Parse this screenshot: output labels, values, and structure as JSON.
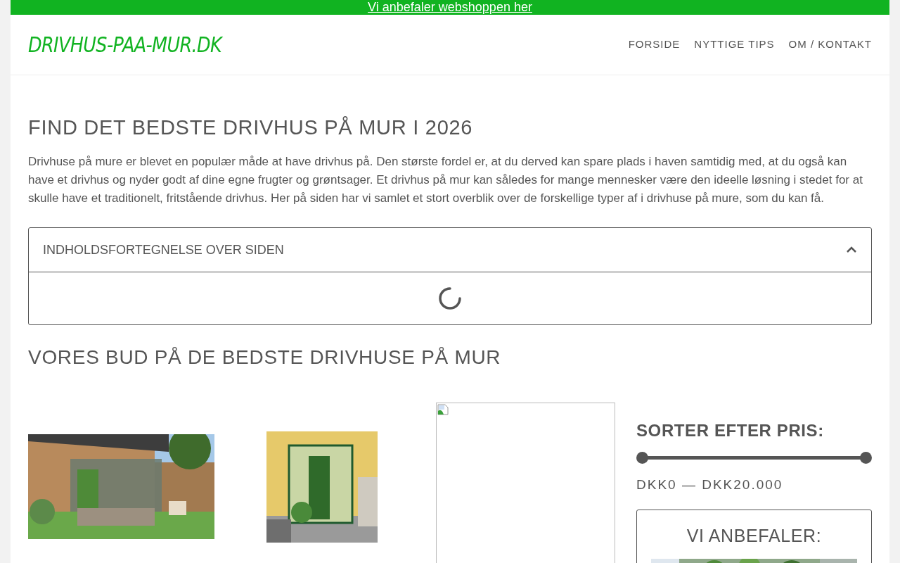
{
  "top_banner": {
    "link": "Vi anbefaler webshoppen her"
  },
  "header": {
    "logo": "DRIVHUS-PAA-MUR.DK",
    "nav": [
      {
        "label": "FORSIDE"
      },
      {
        "label": "NYTTIGE TIPS"
      },
      {
        "label": "OM / KONTAKT"
      }
    ]
  },
  "main": {
    "title": "FIND DET BEDSTE DRIVHUS PÅ MUR I 2026",
    "intro": "Drivhuse på mure er blevet en populær måde at have drivhus på. Den største fordel er, at du derved kan spare plads i haven samtidig med, at du også kan have et drivhus og nyder godt af dine egne frugter og grøntsager. Et drivhus på mur kan således for mange mennesker være den ideelle løsning i stedet for at skulle have et traditionelt, fritstående drivhus. Her på siden har vi samlet et stort overblik over de forskellige typer af i drivhuse på mure, som du kan få.",
    "toc": {
      "title": "INDHOLDSFORTEGNELSE OVER SIDEN",
      "expanded": true,
      "loading": true
    },
    "section_title": "VORES BUD PÅ DE BEDSTE DRIVHUSE PÅ MUR",
    "products": [
      {
        "kind": "picture"
      },
      {
        "kind": "picture"
      },
      {
        "kind": "broken"
      }
    ]
  },
  "sidebar": {
    "sort_title": "SORTER EFTER PRIS:",
    "price_range": "DKK0 — DKK20.000",
    "recommend": {
      "title": "VI ANBEFALER:"
    }
  }
}
